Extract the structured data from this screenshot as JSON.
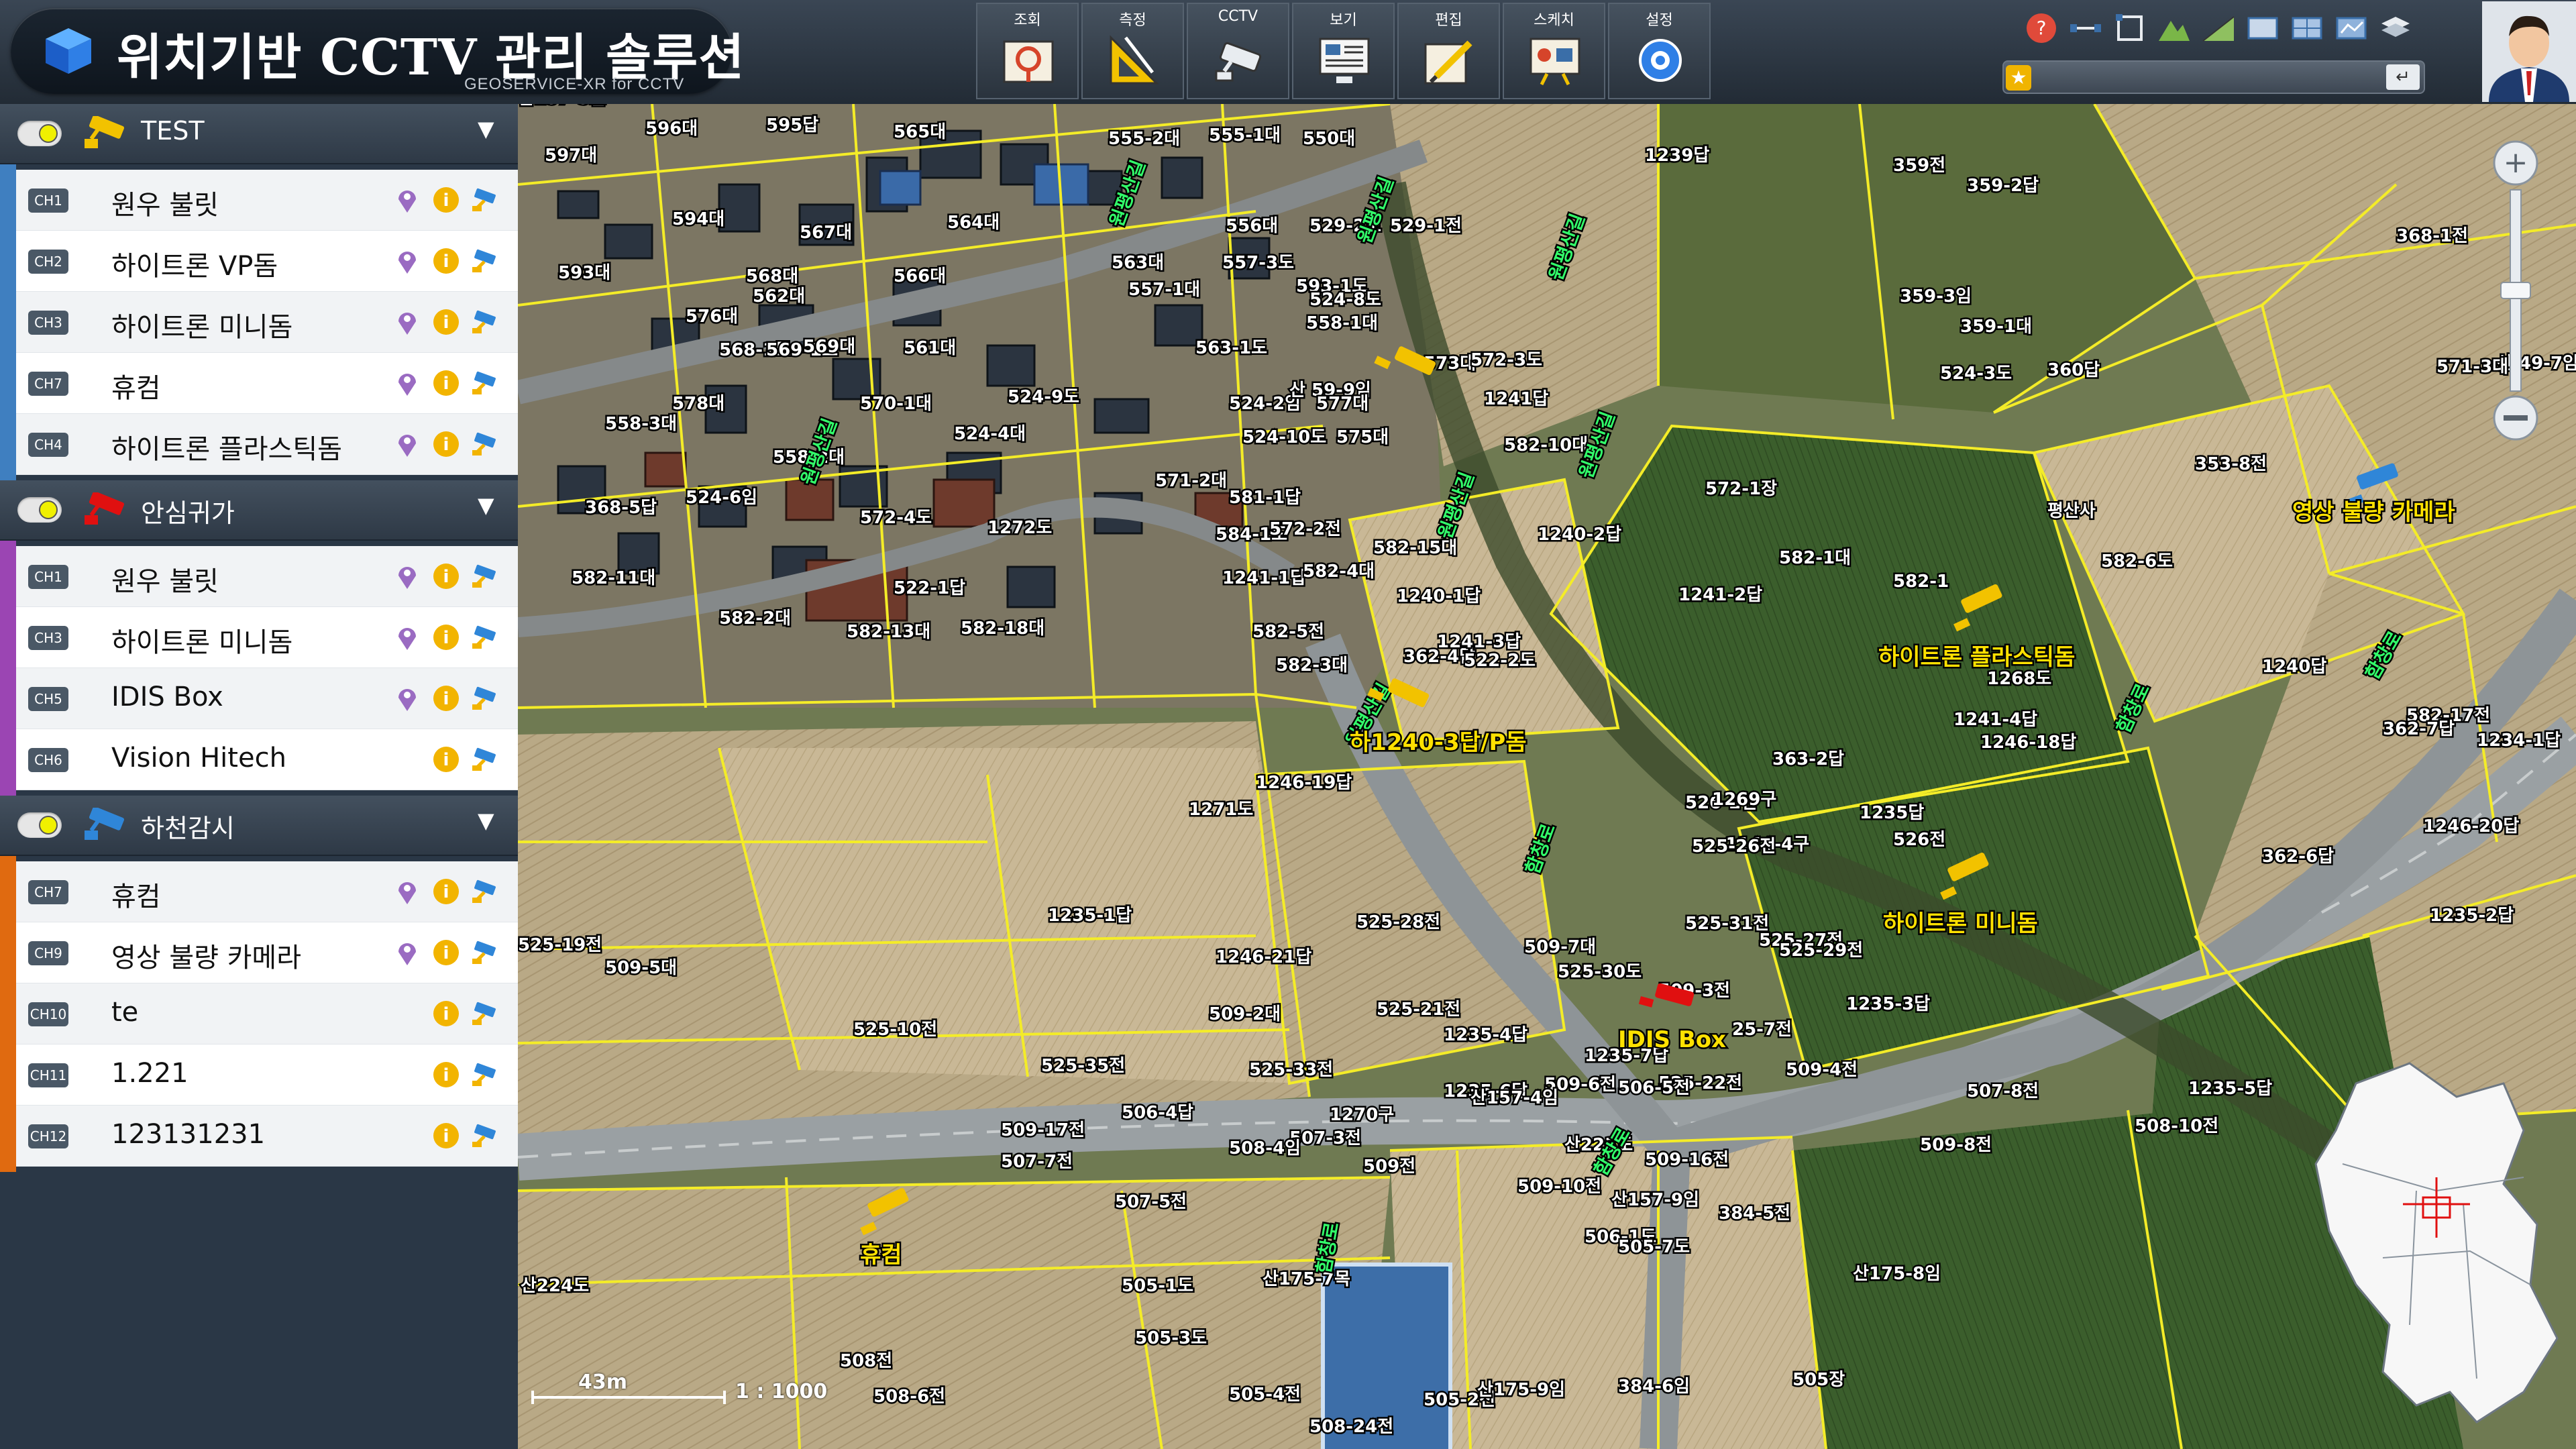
{
  "app": {
    "title": "위치기반 CCTV 관리 솔루션",
    "subtitle": "GEOSERVICE-XR for CCTV"
  },
  "toolbar": [
    {
      "label": "조회",
      "icon": "map-pin-icon"
    },
    {
      "label": "측정",
      "icon": "ruler-triangle-icon"
    },
    {
      "label": "CCTV",
      "icon": "cctv-camera-icon"
    },
    {
      "label": "보기",
      "icon": "monitor-view-icon"
    },
    {
      "label": "편집",
      "icon": "edit-pencil-icon"
    },
    {
      "label": "스케치",
      "icon": "sketch-icon"
    },
    {
      "label": "설정",
      "icon": "settings-gear-icon"
    }
  ],
  "top_icons": [
    "help-icon",
    "distance-icon",
    "area-icon",
    "terrain-icon",
    "slope-icon",
    "map-layer-1-icon",
    "map-layer-2-icon",
    "map-layer-3-icon",
    "layers-stack-icon"
  ],
  "search": {
    "placeholder": "",
    "enter_icon": "↵"
  },
  "groups": [
    {
      "title": "TEST",
      "enabled": true,
      "bar_color": "#3f7fc0",
      "icon_color": "#f2c200",
      "channels": [
        {
          "ch": "CH1",
          "name": "원우 불릿",
          "loc": true
        },
        {
          "ch": "CH2",
          "name": "하이트론 VP돔",
          "loc": true
        },
        {
          "ch": "CH3",
          "name": "하이트론 미니돔",
          "loc": true
        },
        {
          "ch": "CH7",
          "name": "휴컴",
          "loc": true
        },
        {
          "ch": "CH4",
          "name": "하이트론 플라스틱돔",
          "loc": true
        }
      ]
    },
    {
      "title": "안심귀가",
      "enabled": true,
      "bar_color": "#9b45b3",
      "icon_color": "#e01010",
      "channels": [
        {
          "ch": "CH1",
          "name": "원우 불릿",
          "loc": true
        },
        {
          "ch": "CH3",
          "name": "하이트론 미니돔",
          "loc": true
        },
        {
          "ch": "CH5",
          "name": "IDIS Box",
          "loc": true
        },
        {
          "ch": "CH6",
          "name": "Vision Hitech",
          "loc": false
        }
      ]
    },
    {
      "title": "하천감시",
      "enabled": true,
      "bar_color": "#e06a10",
      "icon_color": "#2f86d8",
      "channels": [
        {
          "ch": "CH7",
          "name": "휴컴",
          "loc": true
        },
        {
          "ch": "CH9",
          "name": "영상 불량 카메라",
          "loc": true
        },
        {
          "ch": "CH10",
          "name": "te",
          "loc": false
        },
        {
          "ch": "CH11",
          "name": "1.221",
          "loc": false
        },
        {
          "ch": "CH12",
          "name": "123131231",
          "loc": false
        }
      ]
    }
  ],
  "map": {
    "cameras": [
      {
        "label": "하1240-3답/P돔",
        "color": "#f2c200"
      },
      {
        "label": "하이트론 플라스틱돔",
        "color": "#f2c200"
      },
      {
        "label": "하이트론 미니돔",
        "color": "#f2c200"
      },
      {
        "label": "영상 불량 카메라",
        "color": "#2f86d8"
      },
      {
        "label": "IDIS Box",
        "color": "#e01010"
      },
      {
        "label": "휴컴",
        "color": "#f2c200"
      }
    ],
    "parcel_labels": [
      "596대",
      "595답",
      "597대",
      "565대",
      "555-2대",
      "555-1대",
      "550대",
      "1239답",
      "359전",
      "359-2답",
      "594대",
      "564대",
      "556대",
      "529-2도",
      "529-1전",
      "368-1전",
      "593대",
      "567대",
      "568대",
      "566대",
      "563대",
      "557-3도",
      "593-1도",
      "562대",
      "557-1대",
      "524-8도",
      "359-3임",
      "359-1대",
      "576대",
      "568-1도",
      "569-1도",
      "569대",
      "561대",
      "563-1도",
      "558-1대",
      "524-3도",
      "360답",
      "산 49-7임",
      "578대",
      "570-1대",
      "524-9도",
      "524-2임",
      "산 59-9임",
      "577대",
      "573대",
      "572-3도",
      "571-3대",
      "558-3대",
      "558-2대",
      "524-4대",
      "524-10도",
      "575대",
      "1241답",
      "353-8전",
      "571-2대",
      "524-6임",
      "368-5답",
      "572-4도",
      "581-1답",
      "572-1장",
      "582-10대",
      "1272도",
      "584-1도",
      "572-2전",
      "평산사",
      "1241-1답",
      "582-1대",
      "1240-2답",
      "582-4대",
      "582-15대",
      "582-1",
      "582-6도",
      "582-11대",
      "522-1답",
      "1240-1답",
      "1241-2답",
      "362-4답",
      "582-2대",
      "582-13대",
      "582-18대",
      "582-5전",
      "1241-3답",
      "1268도",
      "582-3대",
      "522-2도",
      "1240답",
      "1241-4답",
      "1246-18답",
      "582-17전",
      "362-6답",
      "363-2답",
      "1246-19답",
      "526-2전",
      "1271도",
      "362-7답",
      "1234-1답",
      "1269구",
      "1235답",
      "526전",
      "1144-4구",
      "1246-20답",
      "1235-2답",
      "525-26전",
      "525-27전",
      "1235-1답",
      "525-31전",
      "525-28전",
      "1246-21답",
      "509-7대",
      "525-29전",
      "25-7전",
      "525-19전",
      "509-5대",
      "509-2대",
      "525-30도",
      "525-21전",
      "1235-4답",
      "1235-3답",
      "509-3전",
      "525-35전",
      "509-4전",
      "525-33전",
      "525-10전",
      "1235-6답",
      "1235-5답",
      "525-22전",
      "1235-7답",
      "506-5전",
      "507-3전",
      "509-6전",
      "1270구",
      "산223도",
      "509전",
      "509-16전",
      "507-7전",
      "506-4답",
      "507-8전",
      "산157-4임",
      "509-8전",
      "509-17전",
      "산157-9임",
      "508-4임",
      "509-10전",
      "507-5전",
      "506-1도",
      "508-10전",
      "산224도",
      "505-1도",
      "384-5전",
      "산175-8임",
      "산175-7목",
      "505-7도",
      "505-3도",
      "505-4전",
      "505-2전",
      "508전",
      "508-6전",
      "508-24전",
      "산175-9임",
      "505장",
      "384-6임",
      "산157-6임",
      "산157-5도"
    ],
    "road_labels": [
      "원평산길",
      "원평산길",
      "원평산길",
      "원평산길",
      "원평산길",
      "원평산길",
      "함창로",
      "함창로",
      "원평산길",
      "함창로",
      "함창로",
      "함창로"
    ],
    "scale_text": "43m",
    "scale_ratio": "1 : 1000"
  }
}
